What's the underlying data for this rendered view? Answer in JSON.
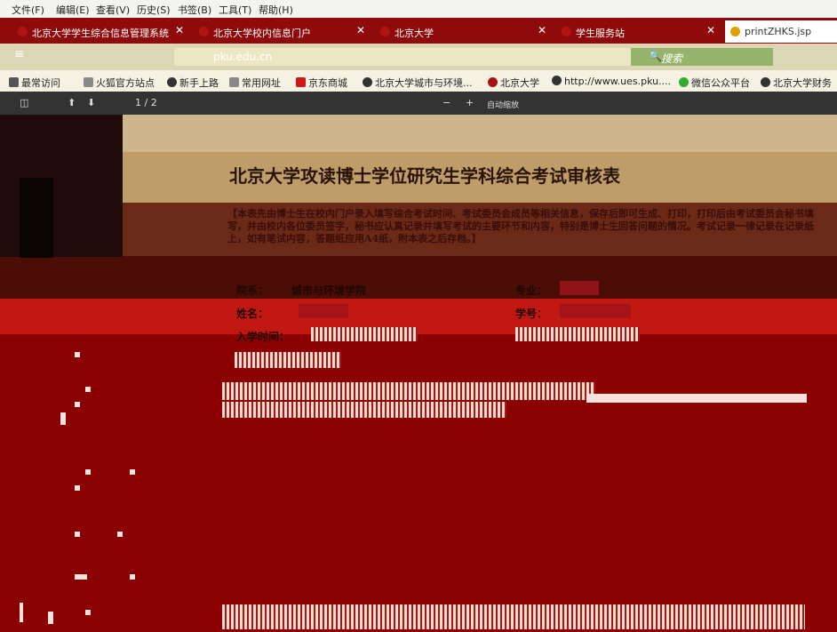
{
  "menu": [
    "文件(F)",
    "编辑(E)",
    "查看(V)",
    "历史(S)",
    "书签(B)",
    "工具(T)",
    "帮助(H)"
  ],
  "tabs": [
    {
      "label": "北京大学学生综合信息管理系统"
    },
    {
      "label": "北京大学校内信息门户"
    },
    {
      "label": "北京大学"
    },
    {
      "label": "学生服务站"
    },
    {
      "label": "printZHKS.jsp"
    }
  ],
  "nav": {
    "url": "pku.edu.cn",
    "search_placeholder": "搜索"
  },
  "bookmarks": [
    {
      "label": "最常访问",
      "icon": "gear-icon"
    },
    {
      "label": "火狐官方站点",
      "icon": "folder-icon"
    },
    {
      "label": "新手上路",
      "icon": "globe-icon"
    },
    {
      "label": "常用网址",
      "icon": "folder-icon"
    },
    {
      "label": "京东商城",
      "icon": "jd-icon"
    },
    {
      "label": "北京大学城市与环境...",
      "icon": "globe-icon"
    },
    {
      "label": "北京大学",
      "icon": "pku-icon"
    },
    {
      "label": "http://www.ues.pku....",
      "icon": "globe-icon"
    },
    {
      "label": "微信公众平台",
      "icon": "wechat-icon"
    },
    {
      "label": "北京大学财务",
      "icon": "globe-icon"
    }
  ],
  "pdf": {
    "page": "1 / 2",
    "zoom": "自动缩放"
  },
  "document": {
    "title": "北京大学攻读博士学位研究生学科综合考试审核表",
    "note": "【本表先由博士生在校内门户录入填写综合考试时间、考试委员会成员等相关信息，保存后即可生成、打印，打印后由考试委员会秘书填写，并由校内各位委员签字，秘书应认真记录并填写考试的主要环节和内容，特别是博士生回答问题的情况。考试记录一律记录在记录纸上，如有笔试内容，答题纸应用A4纸，附本表之后存档。】",
    "fields": {
      "department_label": "院系：",
      "department_value": "城市与环境学院",
      "major_label": "专业：",
      "name_label": "姓名：",
      "student_id_label": "学号：",
      "enroll_label": "入学时间："
    }
  },
  "colors": {
    "tab_bar": "#8f0a0a",
    "artifact_red": "#8b0000"
  }
}
